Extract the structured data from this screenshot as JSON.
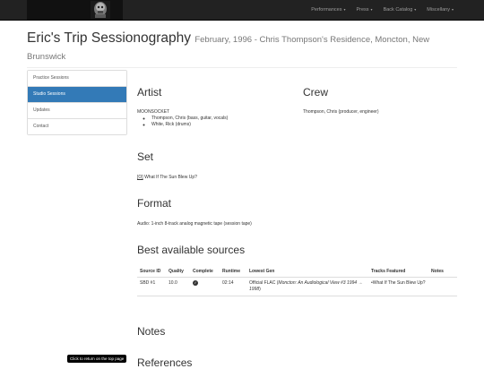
{
  "nav": {
    "items": [
      {
        "label": "Performances"
      },
      {
        "label": "Press"
      },
      {
        "label": "Back Catalog"
      },
      {
        "label": "Miscellany"
      }
    ]
  },
  "header": {
    "title": "Eric's Trip Sessionography",
    "subtitle": "February, 1996 - Chris Thompson's Residence, Moncton, New Brunswick"
  },
  "sidebar": {
    "items": [
      {
        "label": "Practice Sessions"
      },
      {
        "label": "Studio Sessions"
      },
      {
        "label": "Updates"
      },
      {
        "label": "Contact"
      }
    ]
  },
  "artist": {
    "heading": "Artist",
    "band": "MOONSOCKET",
    "members": [
      "Thompson, Chris (bass, guitar, vocals)",
      "White, Rick (drums)"
    ]
  },
  "crew": {
    "heading": "Crew",
    "members": [
      "Thompson, Chris (producer, engineer)"
    ]
  },
  "set": {
    "heading": "Set",
    "marker": "[O]",
    "song": "What If The Sun Blew Up?"
  },
  "format": {
    "heading": "Format",
    "text": "Audio: 1-inch 8-track analog magnetic tape (session tape)"
  },
  "sources": {
    "heading": "Best available sources",
    "columns": {
      "id": "Source ID",
      "quality": "Quality",
      "complete": "Complete",
      "runtime": "Runtime",
      "lowest_gen": "Lowest Gen",
      "tracks": "Tracks Featured",
      "notes": "Notes"
    },
    "rows": [
      {
        "id": "SBD #1",
        "quality": "10.0",
        "runtime": "02:14",
        "gen_prefix": "Official FLAC (",
        "gen_title": "Moncton: An Audiological View #3 1994 → 1998",
        "gen_suffix": ")",
        "tracks": "•What If The Sun Blew Up?",
        "notes": ""
      }
    ]
  },
  "notes": {
    "heading": "Notes"
  },
  "references": {
    "heading": "References"
  },
  "tooltip": "Click to return on the top page"
}
